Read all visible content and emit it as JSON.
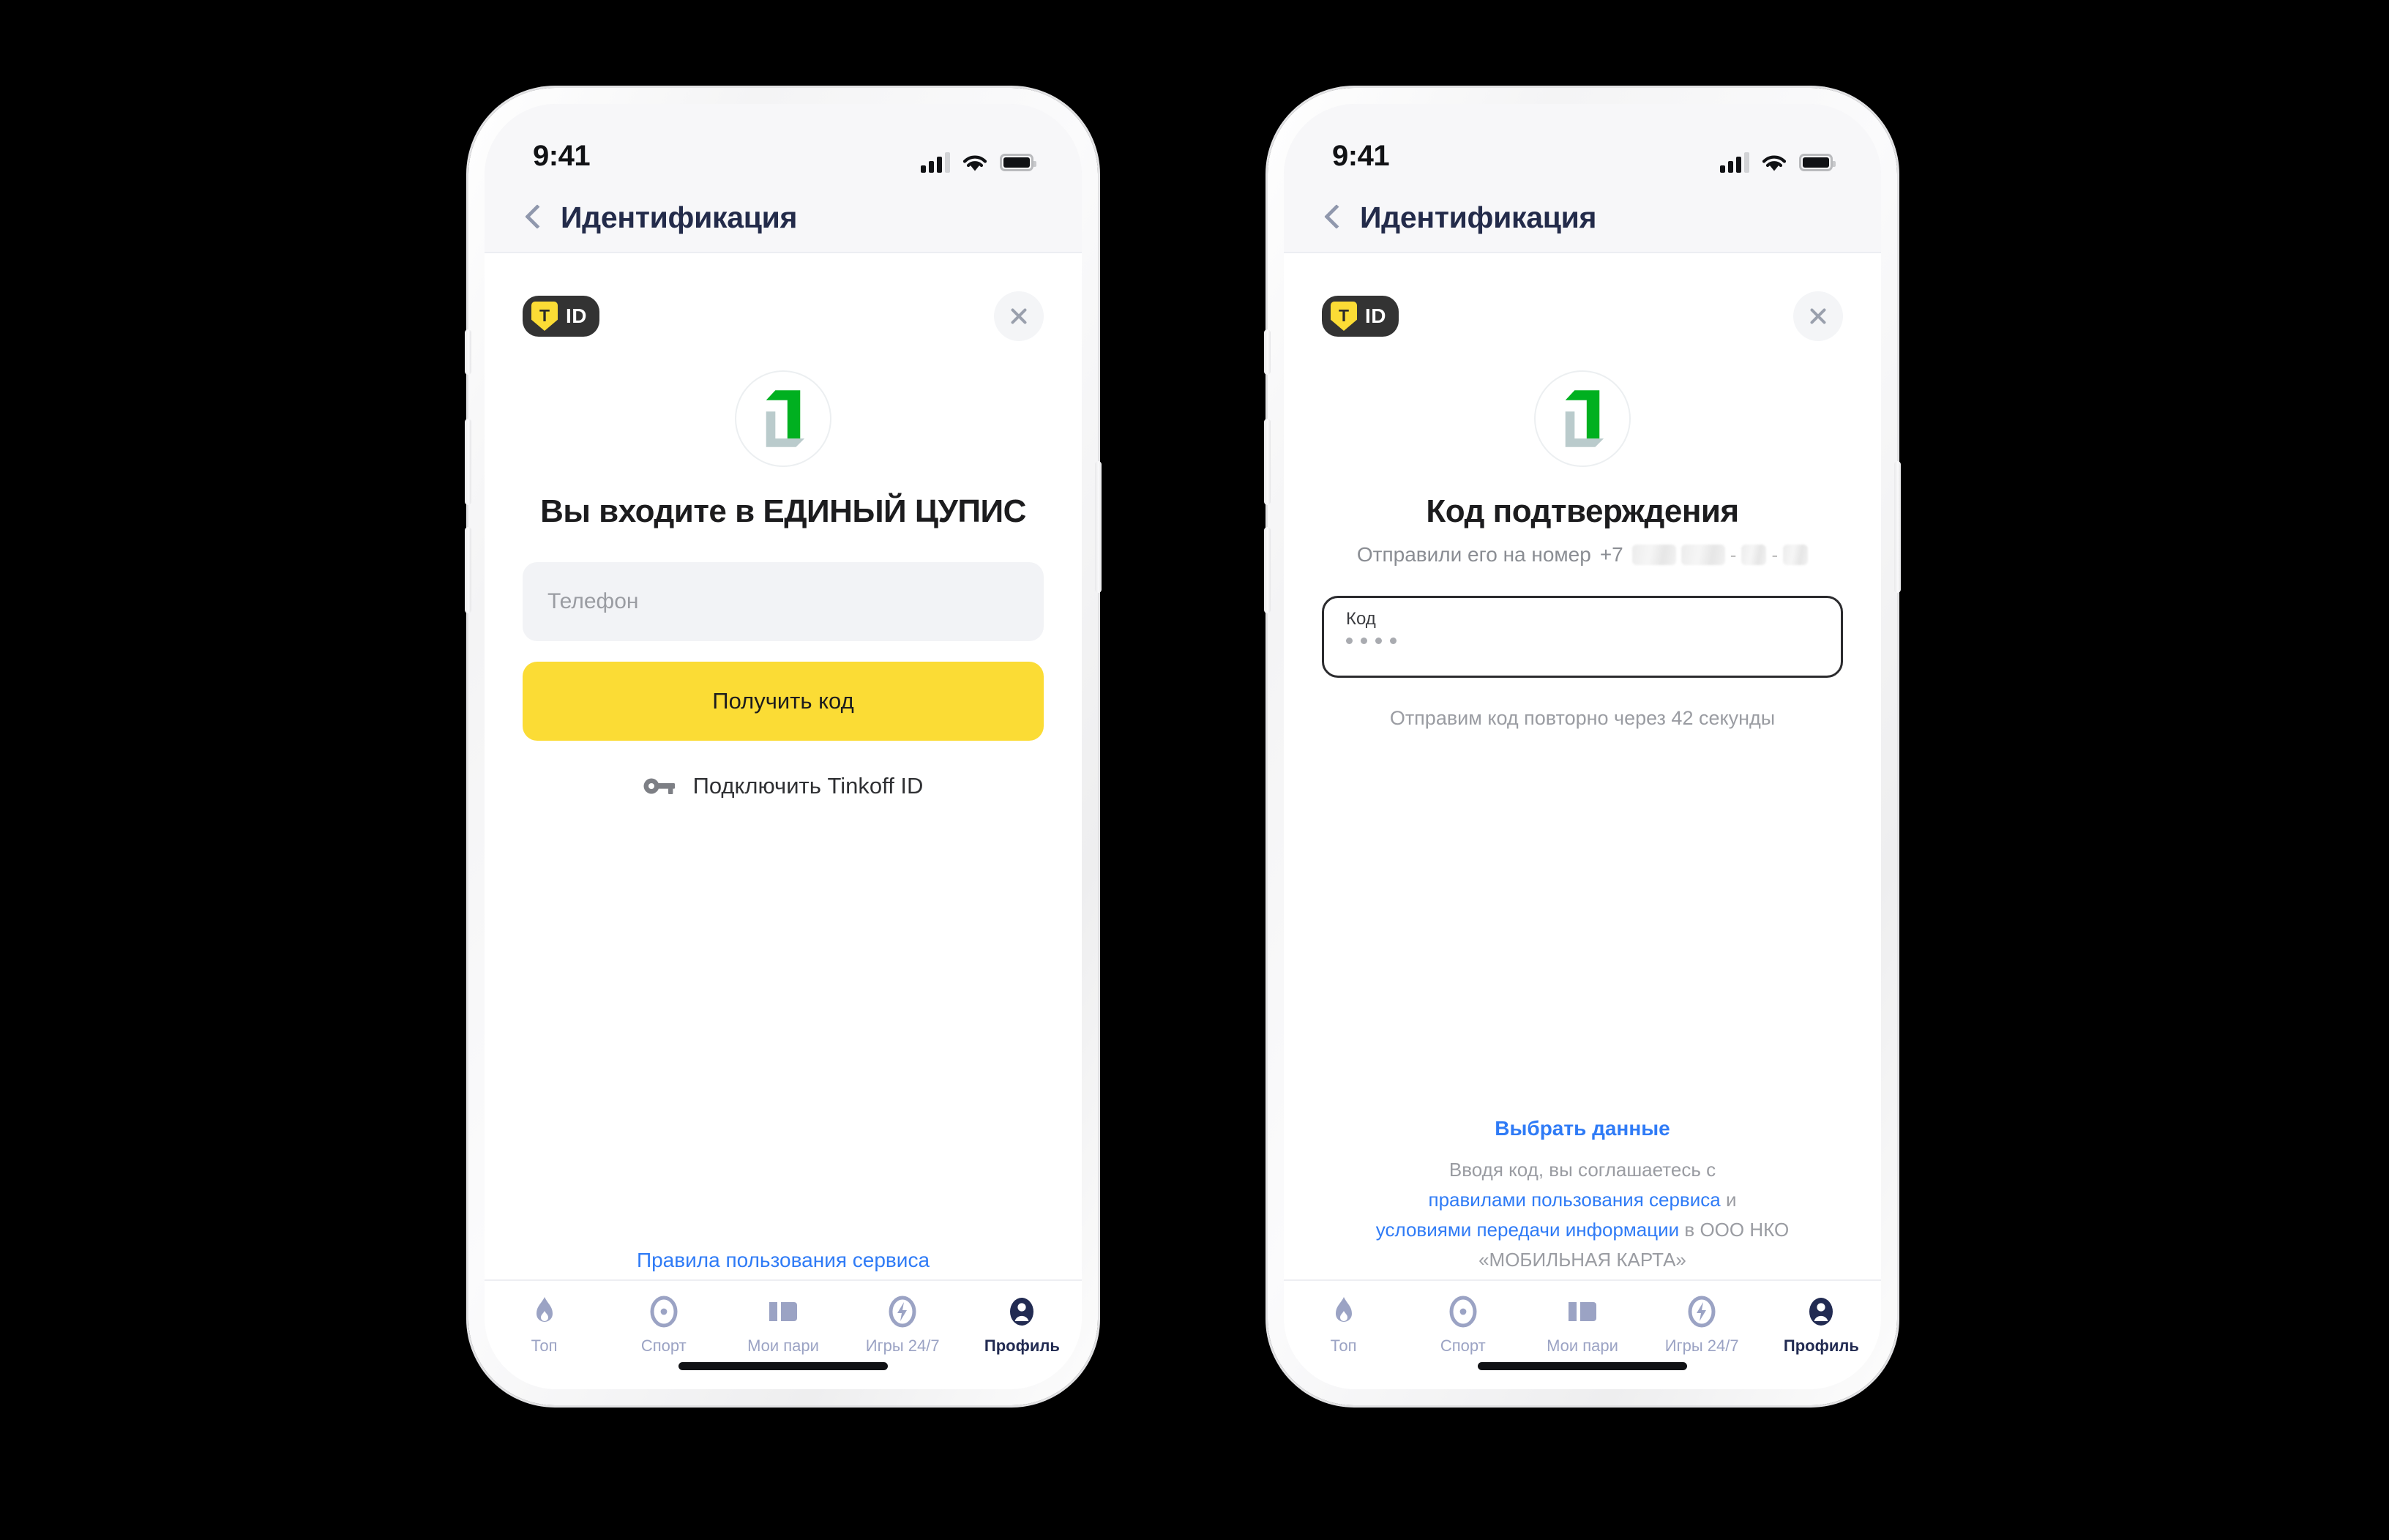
{
  "meta": {
    "background_color": "#000000",
    "accent_yellow": "#FBDC35",
    "accent_blue": "#2F7BF6",
    "brand_green": "#00B020",
    "nav_title_color": "#232B4A"
  },
  "status_bar": {
    "time": "9:41",
    "signal_icon": "signal-bars-icon",
    "wifi_icon": "wifi-icon",
    "battery_icon": "battery-icon"
  },
  "nav": {
    "back_icon": "chevron-left-icon",
    "title": "Идентификация"
  },
  "sheet": {
    "badge": {
      "shield_letter": "T",
      "id_text": "ID",
      "icon": "tinkoff-id-badge-icon"
    },
    "close_icon": "close-icon"
  },
  "logo": {
    "icon": "cupis-logo-icon",
    "green": "#00B020",
    "gray": "#BACBCC"
  },
  "screen_phone": {
    "headline": "Вы входите в ЕДИНЫЙ ЦУПИС",
    "phone_input": {
      "placeholder": "Телефон",
      "value": ""
    },
    "submit_label": "Получить код",
    "connect": {
      "icon": "key-icon",
      "label": "Подключить Tinkoff ID"
    },
    "rules_link": "Правила пользования сервиса"
  },
  "screen_code": {
    "headline": "Код подтверждения",
    "sent_prefix": "Отправили его на номер",
    "phone_country": "+7",
    "phone_redacted": true,
    "code_input": {
      "label": "Код",
      "value": "••••",
      "dots": 4
    },
    "resend_text": "Отправим код повторно через 42 секунды",
    "choose_data_link": "Выбрать данные",
    "legal": {
      "line1": "Вводя код, вы соглашаетесь с",
      "link1": "правилами пользования сервиса",
      "conj": "и",
      "link2": "условиями передачи информации",
      "tail": "в ООО НКО",
      "line4": "«МОБИЛЬНАЯ КАРТА»"
    }
  },
  "tabbar": {
    "items": [
      {
        "label": "Топ",
        "icon": "flame-icon",
        "active": false
      },
      {
        "label": "Спорт",
        "icon": "target-icon",
        "active": false
      },
      {
        "label": "Мои пари",
        "icon": "ticket-icon",
        "active": false
      },
      {
        "label": "Игры 24/7",
        "icon": "lightning-circle-icon",
        "active": false
      },
      {
        "label": "Профиль",
        "icon": "person-icon",
        "active": true
      }
    ]
  }
}
